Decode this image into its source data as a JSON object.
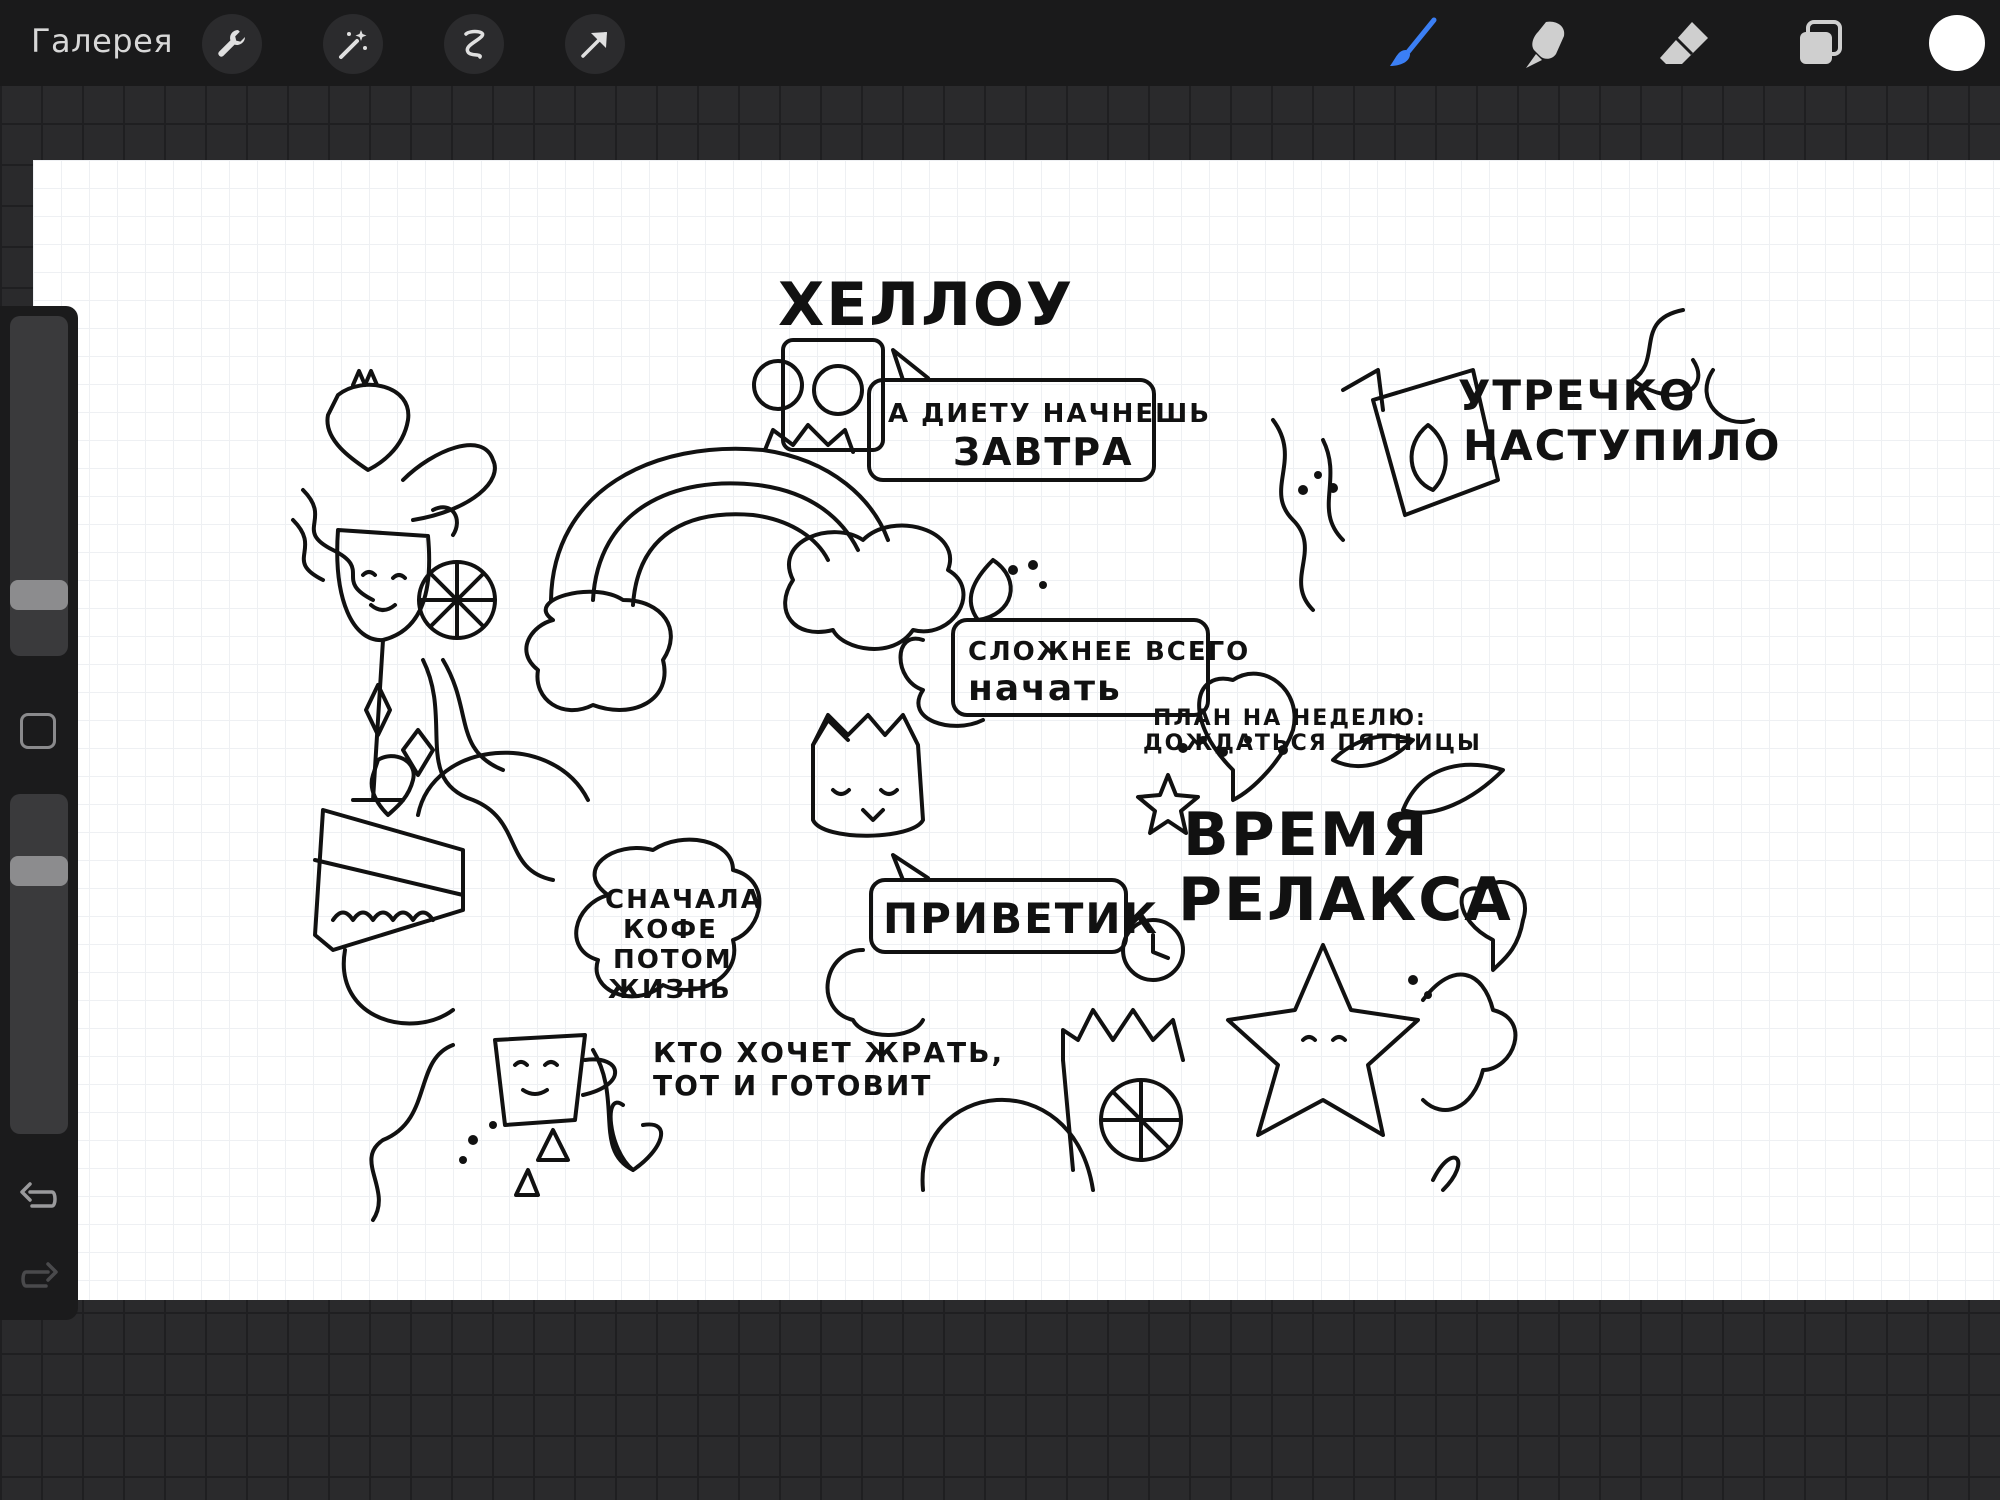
{
  "topbar": {
    "gallery_label": "Галерея",
    "left_tools": [
      "wrench-icon",
      "magic-wand-icon",
      "selection-icon",
      "transform-arrow-icon"
    ],
    "right_tools": [
      "brush-icon",
      "smudge-icon",
      "eraser-icon",
      "layers-icon"
    ],
    "active_tool": "brush",
    "accent_color": "#3b7ff5",
    "current_color": "#ffffff"
  },
  "sidebar": {
    "brush_size_level": 0.15,
    "opacity_level": 0.2,
    "controls": [
      "brush-size-slider",
      "modify-button",
      "opacity-slider",
      "undo-icon",
      "redo-icon"
    ]
  },
  "canvas": {
    "texts": {
      "hello": "ХЕЛЛОУ",
      "diet_1": "А ДИЕТУ НАЧНЕШЬ",
      "diet_2": "ЗАВТРА",
      "morning_1": "УТРЕЧКО",
      "morning_2": "НАСТУПИЛО",
      "hard_1": "СЛОЖНЕЕ ВСЕГО",
      "hard_2": "начать",
      "plan_1": "ПЛАН НА НЕДЕЛЮ:",
      "plan_2": "ДОЖДАТЬСЯ ПЯТНИЦЫ",
      "relax_1": "ВРЕМЯ",
      "relax_2": "РЕЛАКСА",
      "hi": "ПРИВЕТИК",
      "coffee_1": "СНАЧАЛА",
      "coffee_2": "КОФЕ",
      "coffee_3": "ПОТОМ",
      "coffee_4": "ЖИЗНЬ",
      "cook_1": "КТО ХОЧЕТ ЖРАТЬ,",
      "cook_2": "ТОТ И ГОТОВИТ"
    }
  }
}
